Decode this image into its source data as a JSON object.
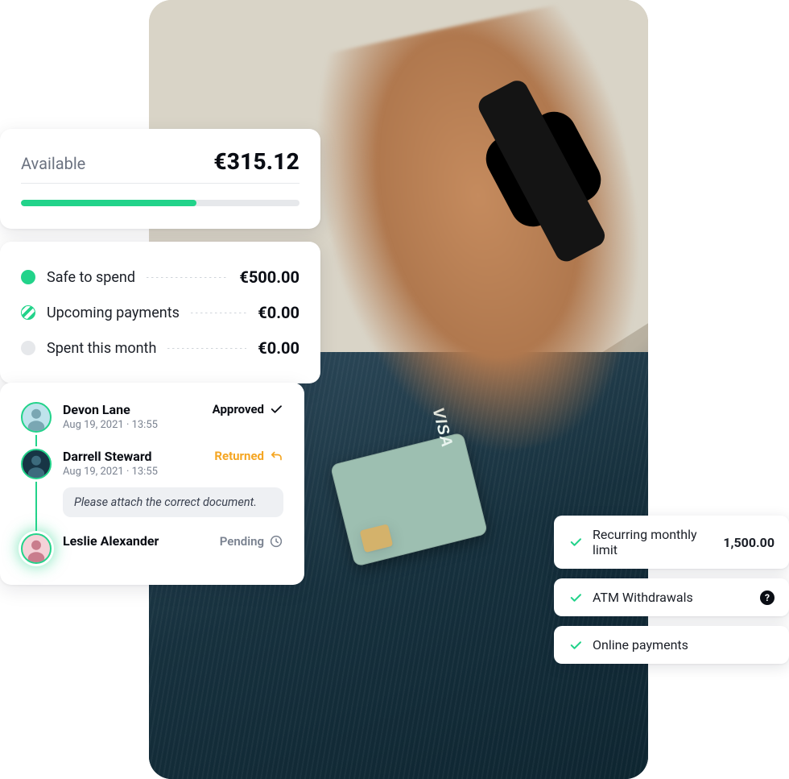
{
  "colors": {
    "accent": "#22d38a",
    "warning": "#f5a623"
  },
  "hero_card_brand": "VISA",
  "balance": {
    "label": "Available",
    "amount": "€315.12",
    "progress_pct": 63
  },
  "budget": {
    "rows": [
      {
        "icon": "dot-green",
        "label": "Safe to spend",
        "value": "€500.00"
      },
      {
        "icon": "dot-stripe",
        "label": "Upcoming payments",
        "value": "€0.00"
      },
      {
        "icon": "dot-grey",
        "label": "Spent this month",
        "value": "€0.00"
      }
    ]
  },
  "approvals": {
    "items": [
      {
        "name": "Devon Lane",
        "timestamp": "Aug 19, 2021 · 13:55",
        "status_label": "Approved",
        "status_kind": "approved"
      },
      {
        "name": "Darrell Steward",
        "timestamp": "Aug 19, 2021 · 13:55",
        "status_label": "Returned",
        "status_kind": "returned",
        "note": "Please attach the correct document."
      },
      {
        "name": "Leslie Alexander",
        "timestamp": "",
        "status_label": "Pending",
        "status_kind": "pending"
      }
    ]
  },
  "features": {
    "items": [
      {
        "label": "Recurring monthly limit",
        "value": "1,500.00",
        "help": false
      },
      {
        "label": "ATM Withdrawals",
        "value": "",
        "help": true
      },
      {
        "label": "Online payments",
        "value": "",
        "help": false
      }
    ]
  }
}
